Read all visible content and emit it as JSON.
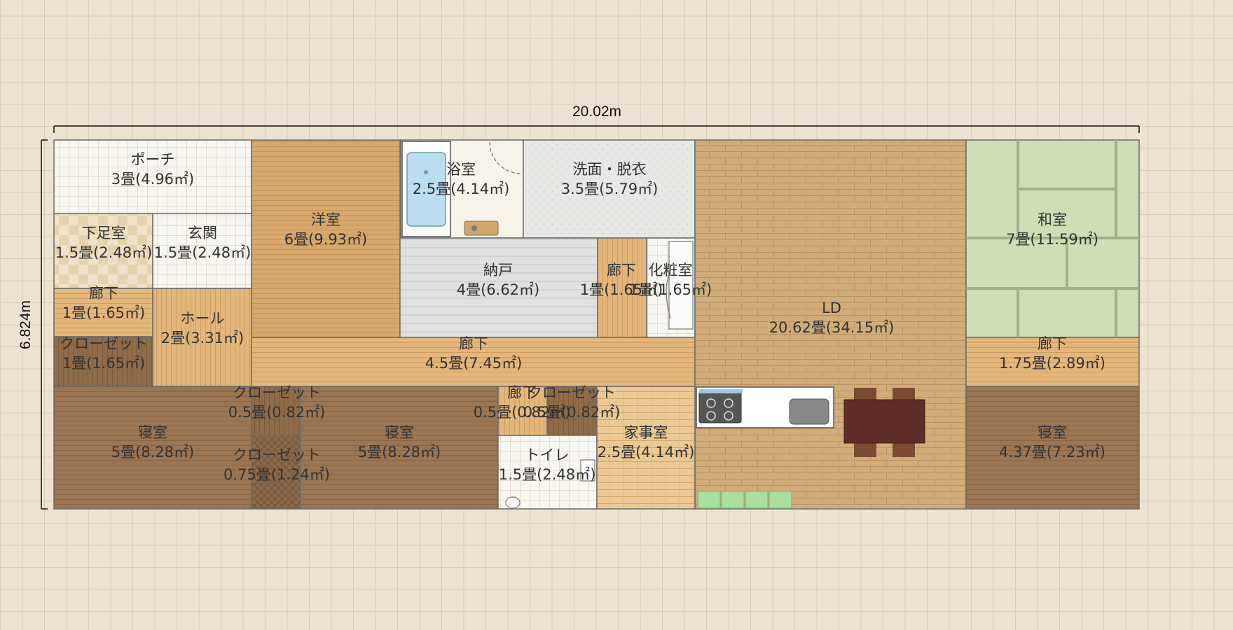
{
  "dimensions": {
    "width": "20.02m",
    "height": "6.824m"
  },
  "rooms": {
    "porch": {
      "name": "ポーチ",
      "area": "3畳(4.96㎡)"
    },
    "shoe_room": {
      "name": "下足室",
      "area": "1.5畳(2.48㎡)"
    },
    "entrance": {
      "name": "玄関",
      "area": "1.5畳(2.48㎡)"
    },
    "hall_left": {
      "name": "廊下",
      "area": "1畳(1.65㎡)"
    },
    "hall_room": {
      "name": "ホール",
      "area": "2畳(3.31㎡)"
    },
    "closet_left": {
      "name": "クローゼット",
      "area": "1畳(1.65㎡)"
    },
    "western": {
      "name": "洋室",
      "area": "6畳(9.93㎡)"
    },
    "bath": {
      "name": "浴室",
      "area": "2.5畳(4.14㎡)"
    },
    "washroom": {
      "name": "洗面・脱衣",
      "area": "3.5畳(5.79㎡)"
    },
    "storage": {
      "name": "納戸",
      "area": "4畳(6.62㎡)"
    },
    "hall_mid": {
      "name": "廊下",
      "area": "1畳(1.65㎡)"
    },
    "powder": {
      "name": "化粧室",
      "area": "1畳(1.65㎡)"
    },
    "hall_long": {
      "name": "廊下",
      "area": "4.5畳(7.45㎡)"
    },
    "ld": {
      "name": "LD",
      "area": "20.62畳(34.15㎡)"
    },
    "washitsu": {
      "name": "和室",
      "area": "7畳(11.59㎡)"
    },
    "hall_right": {
      "name": "廊下",
      "area": "1.75畳(2.89㎡)"
    },
    "bedroom1": {
      "name": "寝室",
      "area": "5畳(8.28㎡)"
    },
    "closet_a": {
      "name": "クローゼット",
      "area": "0.5畳(0.82㎡)"
    },
    "closet_b": {
      "name": "クローゼット",
      "area": "0.75畳(1.24㎡)"
    },
    "bedroom2": {
      "name": "寝室",
      "area": "5畳(8.28㎡)"
    },
    "hall_small": {
      "name": "廊下",
      "area": "0.5畳(0.82㎡)"
    },
    "closet_c": {
      "name": "クローゼット",
      "area": "0.5畳(0.82㎡)"
    },
    "toilet": {
      "name": "トイレ",
      "area": "1.5畳(2.48㎡)"
    },
    "utility": {
      "name": "家事室",
      "area": "2.5畳(4.14㎡)"
    },
    "bedroom3": {
      "name": "寝室",
      "area": "4.37畳(7.23㎡)"
    }
  },
  "colors": {
    "wood_floor": "#e3b77b",
    "dark_floor": "#9c7553",
    "tatami": "#cfdeb6",
    "ld_floor": "#d2ad7a",
    "tile_light": "#f7f5f0",
    "storage_floor": "#dededc"
  }
}
